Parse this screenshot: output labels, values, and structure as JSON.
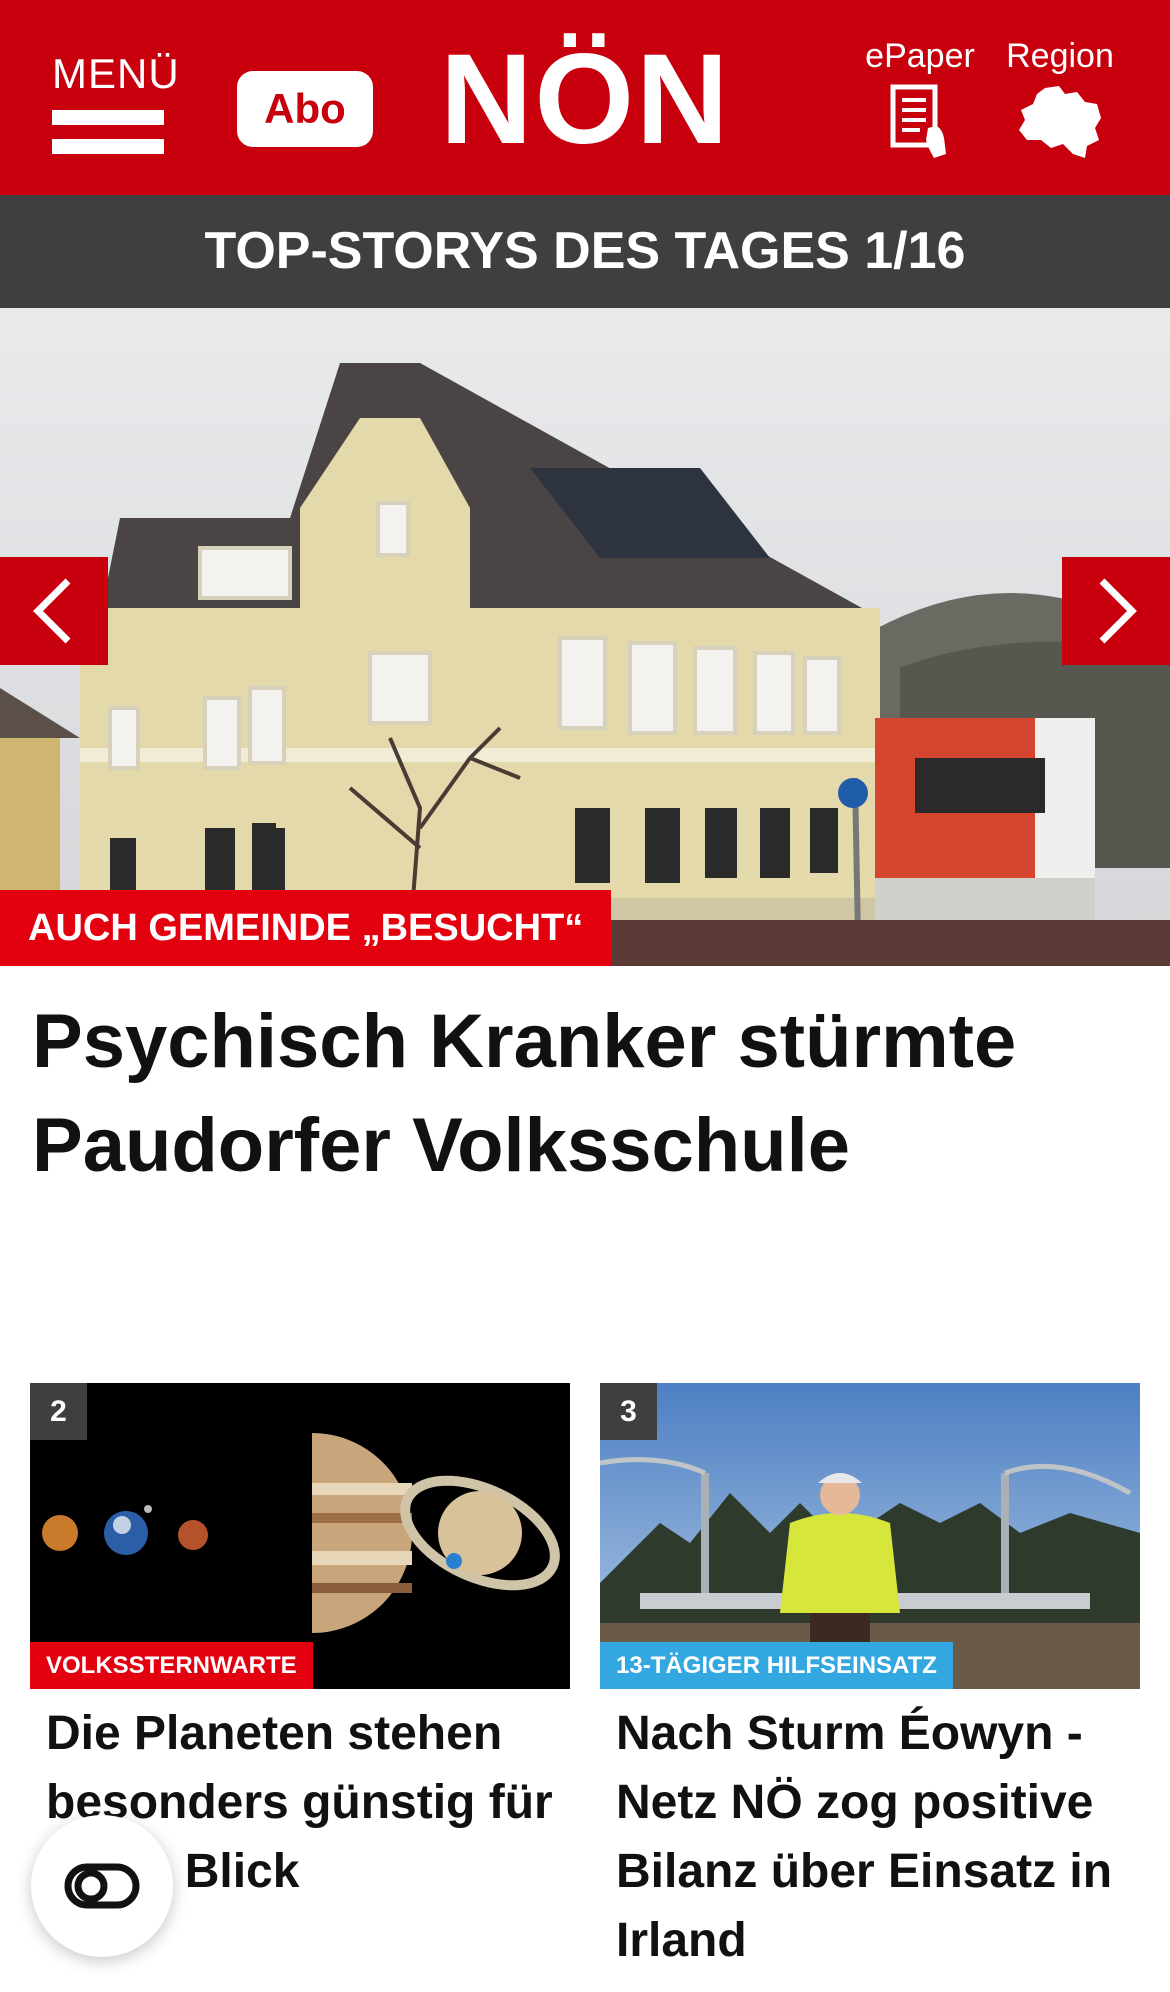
{
  "header": {
    "menu_label": "MENÜ",
    "abo_label": "Abo",
    "logo": "NÖN",
    "epaper_label": "ePaper",
    "region_label": "Region",
    "brand_color": "#c8000e"
  },
  "top_stories": {
    "title": "TOP-STORYS DES TAGES 1/16"
  },
  "hero": {
    "tag": "AUCH GEMEINDE „BESUCHT“",
    "title": "Psychisch Kranker stürmte Paudorfer Volksschule",
    "prev_icon": "chevron-left-icon",
    "next_icon": "chevron-right-icon"
  },
  "cards": [
    {
      "number": "2",
      "tag": "VOLKSSTERNWARTE",
      "tag_color": "#e3000f",
      "title": "Die Planeten stehen besonders günstig für einen Blick"
    },
    {
      "number": "3",
      "tag": "13-TÄGIGER HILFSEINSATZ",
      "tag_color": "#33a7e0",
      "title": "Nach Sturm Éowyn - Netz NÖ zog positive Bilanz über Einsatz in Irland"
    }
  ],
  "floating_button": {
    "icon": "toggle-icon"
  }
}
